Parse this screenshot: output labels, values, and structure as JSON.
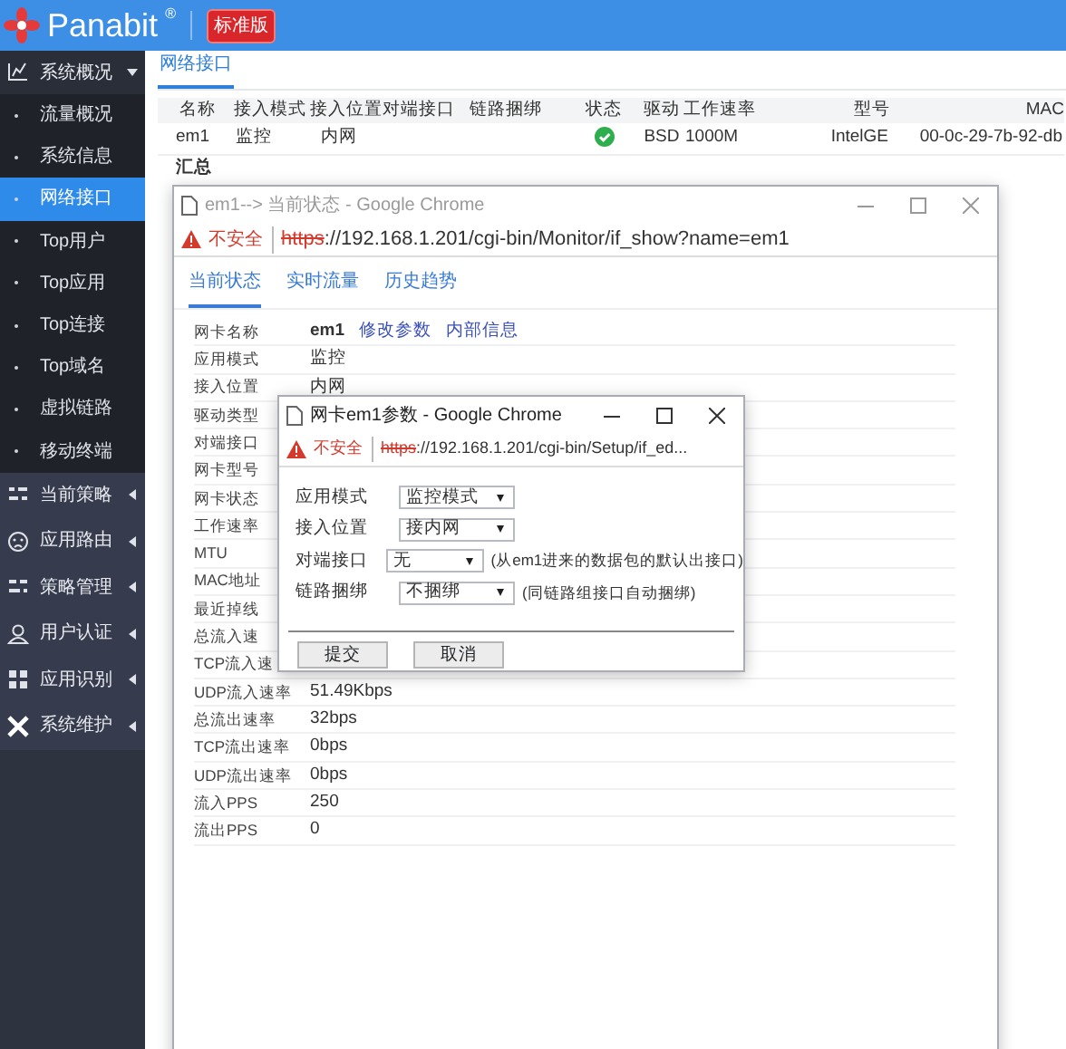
{
  "header": {
    "brand": "Panabit",
    "registered": "®",
    "edition": "标准版"
  },
  "sidebar": {
    "groups": [
      {
        "label": "系统概况",
        "expanded": true,
        "children": [
          {
            "label": "流量概况",
            "selected": false
          },
          {
            "label": "系统信息",
            "selected": false
          },
          {
            "label": "网络接口",
            "selected": true
          },
          {
            "label": "Top用户",
            "selected": false
          },
          {
            "label": "Top应用",
            "selected": false
          },
          {
            "label": "Top连接",
            "selected": false
          },
          {
            "label": "Top域名",
            "selected": false
          },
          {
            "label": "虚拟链路",
            "selected": false
          },
          {
            "label": "移动终端",
            "selected": false
          }
        ]
      },
      {
        "label": "当前策略",
        "expanded": false
      },
      {
        "label": "应用路由",
        "expanded": false
      },
      {
        "label": "策略管理",
        "expanded": false
      },
      {
        "label": "用户认证",
        "expanded": false
      },
      {
        "label": "应用识别",
        "expanded": false
      },
      {
        "label": "系统维护",
        "expanded": false
      }
    ]
  },
  "page": {
    "tabs": [
      {
        "label": "网络接口",
        "selected": true
      }
    ],
    "table": {
      "columns": [
        "名称",
        "接入模式",
        "接入位置",
        "对端接口",
        "链路捆绑",
        "状态",
        "驱动",
        "工作速率",
        "型号",
        "MAC"
      ],
      "rows": [
        {
          "name": "em1",
          "mode": "监控",
          "position": "内网",
          "online": true,
          "driver": "BSD",
          "speed": "1000M",
          "model": "IntelGE",
          "mac": "00-0c-29-7b-92-db"
        }
      ]
    },
    "summary_label": "汇总"
  },
  "status_window": {
    "title": "em1--> 当前状态 - Google Chrome",
    "active": false,
    "security": "不安全",
    "url_scheme": "https",
    "url_rest": "://192.168.1.201/cgi-bin/Monitor/if_show?name=em1",
    "tabs": [
      {
        "label": "当前状态",
        "selected": true
      },
      {
        "label": "实时流量",
        "selected": false
      },
      {
        "label": "历史趋势",
        "selected": false
      }
    ],
    "rows": [
      {
        "label": "网卡名称",
        "value": "em1",
        "links": [
          "修改参数",
          "内部信息"
        ]
      },
      {
        "label": "应用模式",
        "value": "监控"
      },
      {
        "label": "接入位置",
        "value": "内网"
      },
      {
        "label": "驱动类型"
      },
      {
        "label": "对端接口"
      },
      {
        "label": "网卡型号"
      },
      {
        "label": "网卡状态"
      },
      {
        "label": "工作速率"
      },
      {
        "label": "MTU"
      },
      {
        "label": "MAC地址"
      },
      {
        "label": "最近掉线"
      },
      {
        "label": "总流入速"
      },
      {
        "label": "TCP流入速"
      },
      {
        "label": "UDP流入速率",
        "value": "51.49Kbps"
      },
      {
        "label": "总流出速率",
        "value": "32bps"
      },
      {
        "label": "TCP流出速率",
        "value": "0bps"
      },
      {
        "label": "UDP流出速率",
        "value": "0bps"
      },
      {
        "label": "流入PPS",
        "value": "250"
      },
      {
        "label": "流出PPS",
        "value": "0"
      }
    ]
  },
  "dialog": {
    "title": "网卡em1参数 - Google Chrome",
    "active": true,
    "security": "不安全",
    "url_scheme": "https",
    "url_rest": "://192.168.1.201/cgi-bin/Setup/if_ed...",
    "fields": [
      {
        "label": "应用模式",
        "value": "监控模式"
      },
      {
        "label": "接入位置",
        "value": "接内网"
      },
      {
        "label": "对端接口",
        "value": "无",
        "hint": "(从em1进来的数据包的默认出接口)"
      },
      {
        "label": "链路捆绑",
        "value": "不捆绑",
        "hint": "(同链路组接口自动捆绑)"
      }
    ],
    "buttons": [
      "提交",
      "取消"
    ]
  }
}
